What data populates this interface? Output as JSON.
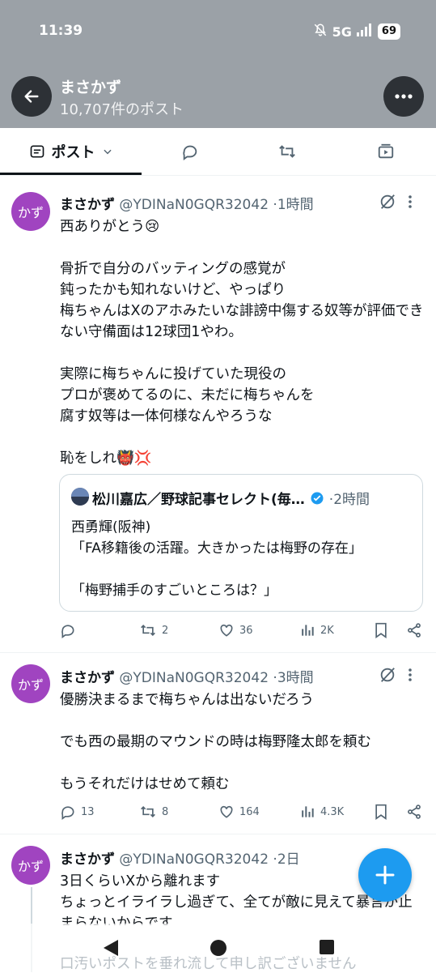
{
  "status_bar": {
    "time": "11:39",
    "network": "5G",
    "battery": "69"
  },
  "header": {
    "name": "まさかず",
    "post_count": "10,707件のポスト"
  },
  "tabs": [
    {
      "label": "ポスト"
    }
  ],
  "posts": [
    {
      "avatar_text": "かず",
      "name": "まさかず",
      "handle": "@YDINaN0GQR32042",
      "sep": "·",
      "time": "1時間",
      "text": "西ありがとう😢\n\n骨折で自分のバッティングの感覚が\n鈍ったかも知れないけど、やっぱり\n梅ちゃんはXのアホみたいな誹謗中傷する奴等が評価できない守備面は12球団1やわ。\n\n実際に梅ちゃんに投げていた現役の\nプロが褒めてるのに、未だに梅ちゃんを\n腐す奴等は一体何様なんやろうな\n\n恥をしれ👹💢",
      "quote": {
        "name": "松川嘉広／野球記事セレクト(毎…",
        "sep": "·",
        "time": "2時間",
        "text": "西勇輝(阪神)\n「FA移籍後の活躍。大きかったは梅野の存在」\n\n「梅野捕手のすごいところは？」"
      },
      "replies": "",
      "reposts": "2",
      "likes": "36",
      "views": "2K"
    },
    {
      "avatar_text": "かず",
      "name": "まさかず",
      "handle": "@YDINaN0GQR32042",
      "sep": "·",
      "time": "3時間",
      "text": "優勝決まるまで梅ちゃんは出ないだろう\n\nでも西の最期のマウンドの時は梅野隆太郎を頼む\n\nもうそれだけはせめて頼む",
      "replies": "13",
      "reposts": "8",
      "likes": "164",
      "views": "4.3K"
    },
    {
      "avatar_text": "かず",
      "name": "まさかず",
      "handle": "@YDINaN0GQR32042",
      "sep": "·",
      "time": "2日",
      "text": "3日くらいXから離れます\nちょっとイライラし過ぎて、全てが敵に見えて暴言が止まらないからです",
      "text_faded": "口汚いポストを垂れ流して申し訳ございません"
    }
  ],
  "colors": {
    "header_bg": "#9ba1a7",
    "accent": "#1d9bf0",
    "avatar": "#a044c0",
    "verified": "#1d9bf0"
  }
}
